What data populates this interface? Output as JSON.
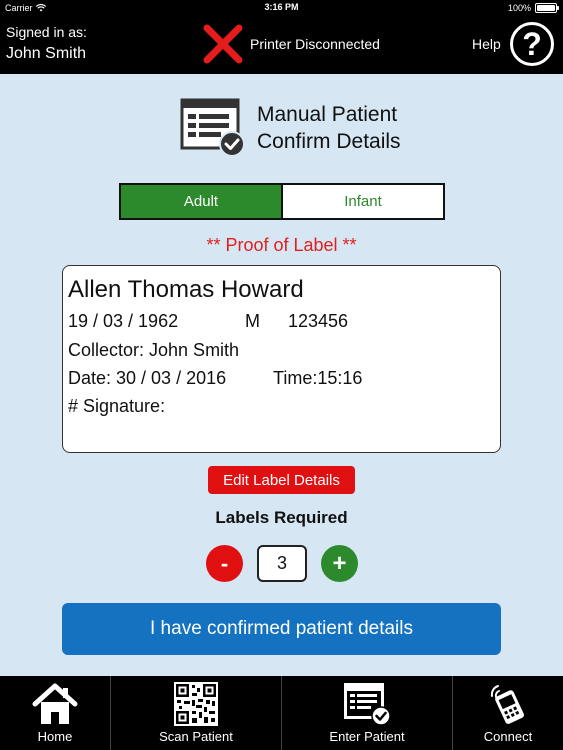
{
  "statusbar": {
    "carrier": "Carrier",
    "time": "3:16 PM",
    "battery": "100%",
    "battery_level": 1.0
  },
  "header": {
    "signed_in_label": "Signed in as:",
    "user_name": "John Smith",
    "printer_status": "Printer Disconnected",
    "help_label": "Help",
    "help_glyph": "?"
  },
  "page": {
    "title_line1": "Manual Patient",
    "title_line2": "Confirm Details"
  },
  "toggle": {
    "adult": "Adult",
    "infant": "Infant",
    "selected": "Adult"
  },
  "proof_label": "** Proof of Label **",
  "label": {
    "name": "Allen Thomas Howard",
    "dob": "19 / 03 / 1962",
    "sex": "M",
    "id": "123456",
    "collector": "Collector: John Smith",
    "date": "Date: 30 / 03 / 2016",
    "time": "Time:15:16",
    "signature": "# Signature:"
  },
  "edit_button": "Edit Label Details",
  "labels_required": {
    "title": "Labels Required",
    "minus": "-",
    "value": "3",
    "plus": "+"
  },
  "confirm_button": "I have confirmed patient details",
  "tabs": [
    {
      "label": "Home",
      "icon": "home-icon"
    },
    {
      "label": "Scan Patient",
      "icon": "qr-code-icon"
    },
    {
      "label": "Enter Patient",
      "icon": "form-check-icon"
    },
    {
      "label": "Connect",
      "icon": "card-reader-icon"
    }
  ],
  "colors": {
    "background": "#d6e7f3",
    "header": "#000000",
    "accent_green": "#2c8a2c",
    "accent_red": "#e01010",
    "accent_blue": "#1472c0"
  }
}
